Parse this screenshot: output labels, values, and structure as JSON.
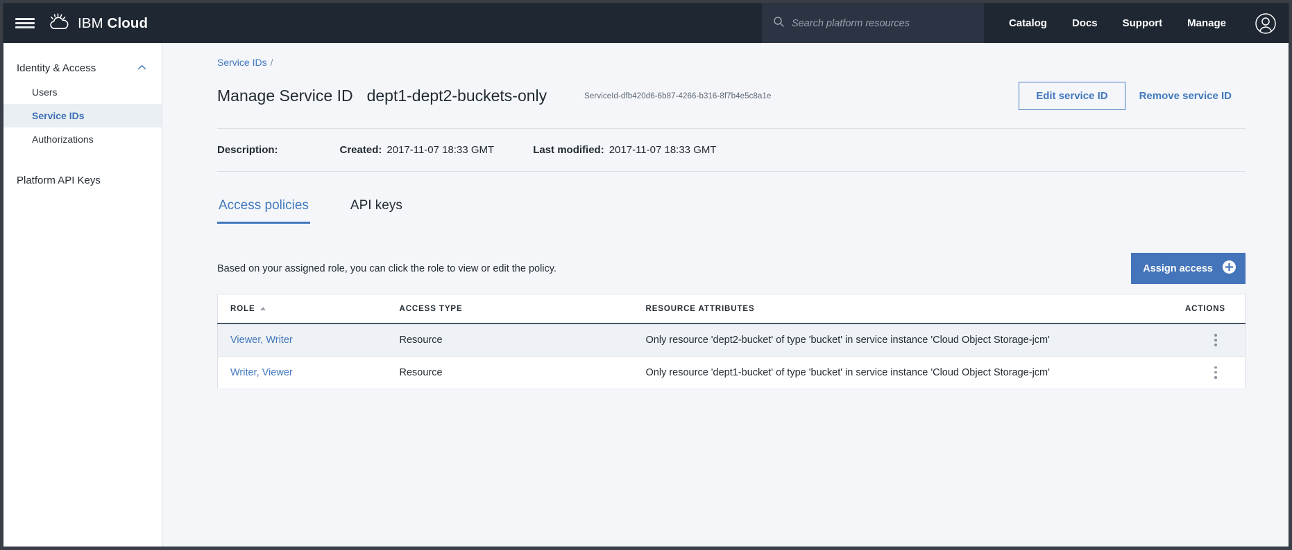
{
  "topnav": {
    "menu_icon": "hamburger-icon",
    "brand_prefix": "IBM",
    "brand_suffix": "Cloud",
    "brand_logo_icon": "ibm-cloud-logo-icon",
    "search": {
      "icon": "search-icon",
      "placeholder": "Search platform resources",
      "value": ""
    },
    "links": [
      "Catalog",
      "Docs",
      "Support",
      "Manage"
    ],
    "account_icon": "user-avatar-icon",
    "background_color": "#1f2733"
  },
  "sidebar": {
    "group": {
      "label": "Identity & Access",
      "chevron_icon": "chevron-up-icon",
      "expanded": true
    },
    "items": [
      {
        "label": "Users",
        "active": false
      },
      {
        "label": "Service IDs",
        "active": true
      },
      {
        "label": "Authorizations",
        "active": false
      }
    ],
    "top_links": [
      {
        "label": "Platform API Keys"
      }
    ],
    "active_color": "#3b6fb5"
  },
  "main": {
    "breadcrumb": {
      "items": [
        "Service IDs"
      ],
      "separator": "/"
    },
    "title": {
      "label": "Manage Service ID",
      "value": "dept1-dept2-buckets-only",
      "guid": "ServiceId-dfb420d6-6b87-4266-b316-8f7b4e5c8a1e"
    },
    "actions": {
      "edit_label": "Edit service ID",
      "remove_label": "Remove service ID",
      "link_color": "#4178be"
    },
    "meta": {
      "description_label": "Description:",
      "description_value": "",
      "created_label": "Created:",
      "created_value": "2017-11-07 18:33 GMT",
      "modified_label": "Last modified:",
      "modified_value": "2017-11-07 18:33 GMT"
    },
    "tabs": [
      {
        "label": "Access policies",
        "active": true
      },
      {
        "label": "API keys",
        "active": false
      }
    ],
    "toolbar": {
      "hint": "Based on your assigned role, you can click the role to view or edit the policy.",
      "assign_access_label": "Assign access",
      "assign_access_icon": "plus-circle-icon",
      "assign_access_color": "#4474ba"
    },
    "table": {
      "columns": [
        {
          "key": "role",
          "label": "ROLE",
          "sorted": "asc",
          "sort_icon": "caret-up-icon"
        },
        {
          "key": "access_type",
          "label": "ACCESS TYPE"
        },
        {
          "key": "resource_attributes",
          "label": "RESOURCE ATTRIBUTES"
        },
        {
          "key": "actions",
          "label": "ACTIONS"
        }
      ],
      "rows": [
        {
          "role": "Viewer, Writer",
          "access_type": "Resource",
          "resource_attributes": "Only resource 'dept2-bucket' of type 'bucket' in service instance 'Cloud Object Storage-jcm'",
          "actions_icon": "overflow-menu-icon"
        },
        {
          "role": "Writer, Viewer",
          "access_type": "Resource",
          "resource_attributes": "Only resource 'dept1-bucket' of type 'bucket' in service instance 'Cloud Object Storage-jcm'",
          "actions_icon": "overflow-menu-icon"
        }
      ]
    }
  }
}
